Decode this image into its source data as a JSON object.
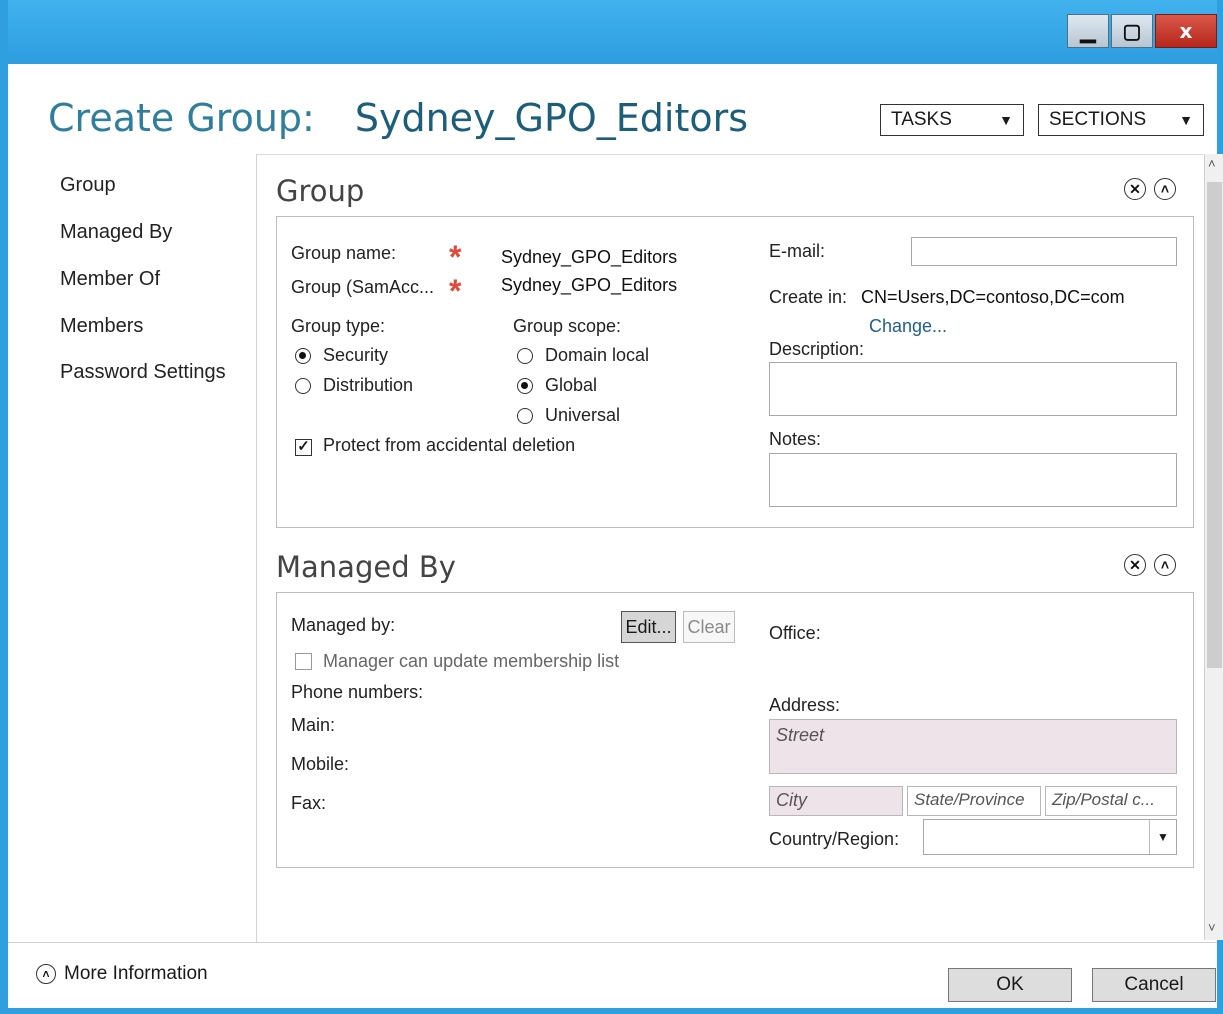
{
  "window": {
    "title": "Create Group:",
    "group_name_heading": "Sydney_GPO_Editors",
    "minimize_glyph": "▁",
    "maximize_glyph": "▢",
    "close_glyph": "x"
  },
  "toolbar": {
    "tasks_label": "TASKS",
    "sections_label": "SECTIONS",
    "caret": "▼"
  },
  "nav": {
    "items": [
      {
        "label": "Group"
      },
      {
        "label": "Managed By"
      },
      {
        "label": "Member Of"
      },
      {
        "label": "Members"
      },
      {
        "label": "Password Settings"
      }
    ]
  },
  "group_section": {
    "title": "Group",
    "group_name_label": "Group name:",
    "group_name_value": "Sydney_GPO_Editors",
    "sam_label": "Group (SamAcc...",
    "sam_value": "Sydney_GPO_Editors",
    "required_glyph": "*",
    "group_type_label": "Group type:",
    "type_options": [
      "Security",
      "Distribution"
    ],
    "selected_type": "Security",
    "group_scope_label": "Group scope:",
    "scope_options": [
      "Domain local",
      "Global",
      "Universal"
    ],
    "selected_scope": "Global",
    "protect_label": "Protect from accidental deletion",
    "protect_checked": true,
    "email_label": "E-mail:",
    "email_value": "",
    "create_in_label": "Create in:",
    "create_in_value": "CN=Users,DC=contoso,DC=com",
    "change_link": "Change...",
    "description_label": "Description:",
    "description_value": "",
    "notes_label": "Notes:",
    "notes_value": ""
  },
  "managed_section": {
    "title": "Managed By",
    "managed_by_label": "Managed by:",
    "edit_label": "Edit...",
    "clear_label": "Clear",
    "manager_update_label": "Manager can update membership list",
    "manager_update_checked": false,
    "phone_numbers_label": "Phone numbers:",
    "main_label": "Main:",
    "mobile_label": "Mobile:",
    "fax_label": "Fax:",
    "office_label": "Office:",
    "address_label": "Address:",
    "street_placeholder": "Street",
    "city_placeholder": "City",
    "state_placeholder": "State/Province",
    "zip_placeholder": "Zip/Postal c...",
    "country_label": "Country/Region:",
    "country_value": ""
  },
  "footer": {
    "more_info_label": "More Information",
    "ok_label": "OK",
    "cancel_label": "Cancel"
  }
}
